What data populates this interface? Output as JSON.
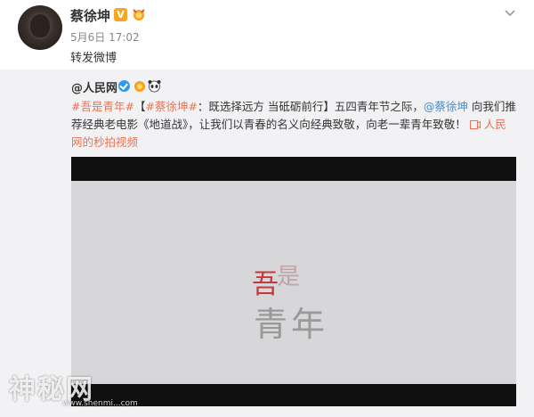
{
  "post": {
    "username": "蔡徐坤",
    "verified_label": "V",
    "time": "5月6日 17:02",
    "text": "转发微博"
  },
  "repost": {
    "author": "@人民网",
    "body": {
      "hashtag1": "#吾是青年#",
      "bracket_open": "【",
      "hashtag2": "#蔡徐坤#",
      "headline": "：既选择远方 当砥砺前行】五四青年节之际，",
      "mention": "@蔡徐坤",
      "text1": " 向我们推荐经典老电影《地道战》，让我们以青春的名义向经典致敬，向老一辈青年致敬！",
      "video_link": "人民网的秒拍视频"
    }
  },
  "video": {
    "title_top": "吾",
    "title_top_small": "是",
    "title_bottom": "青年"
  },
  "watermark": {
    "text": "神秘网",
    "url": "www.shenmi...com"
  }
}
